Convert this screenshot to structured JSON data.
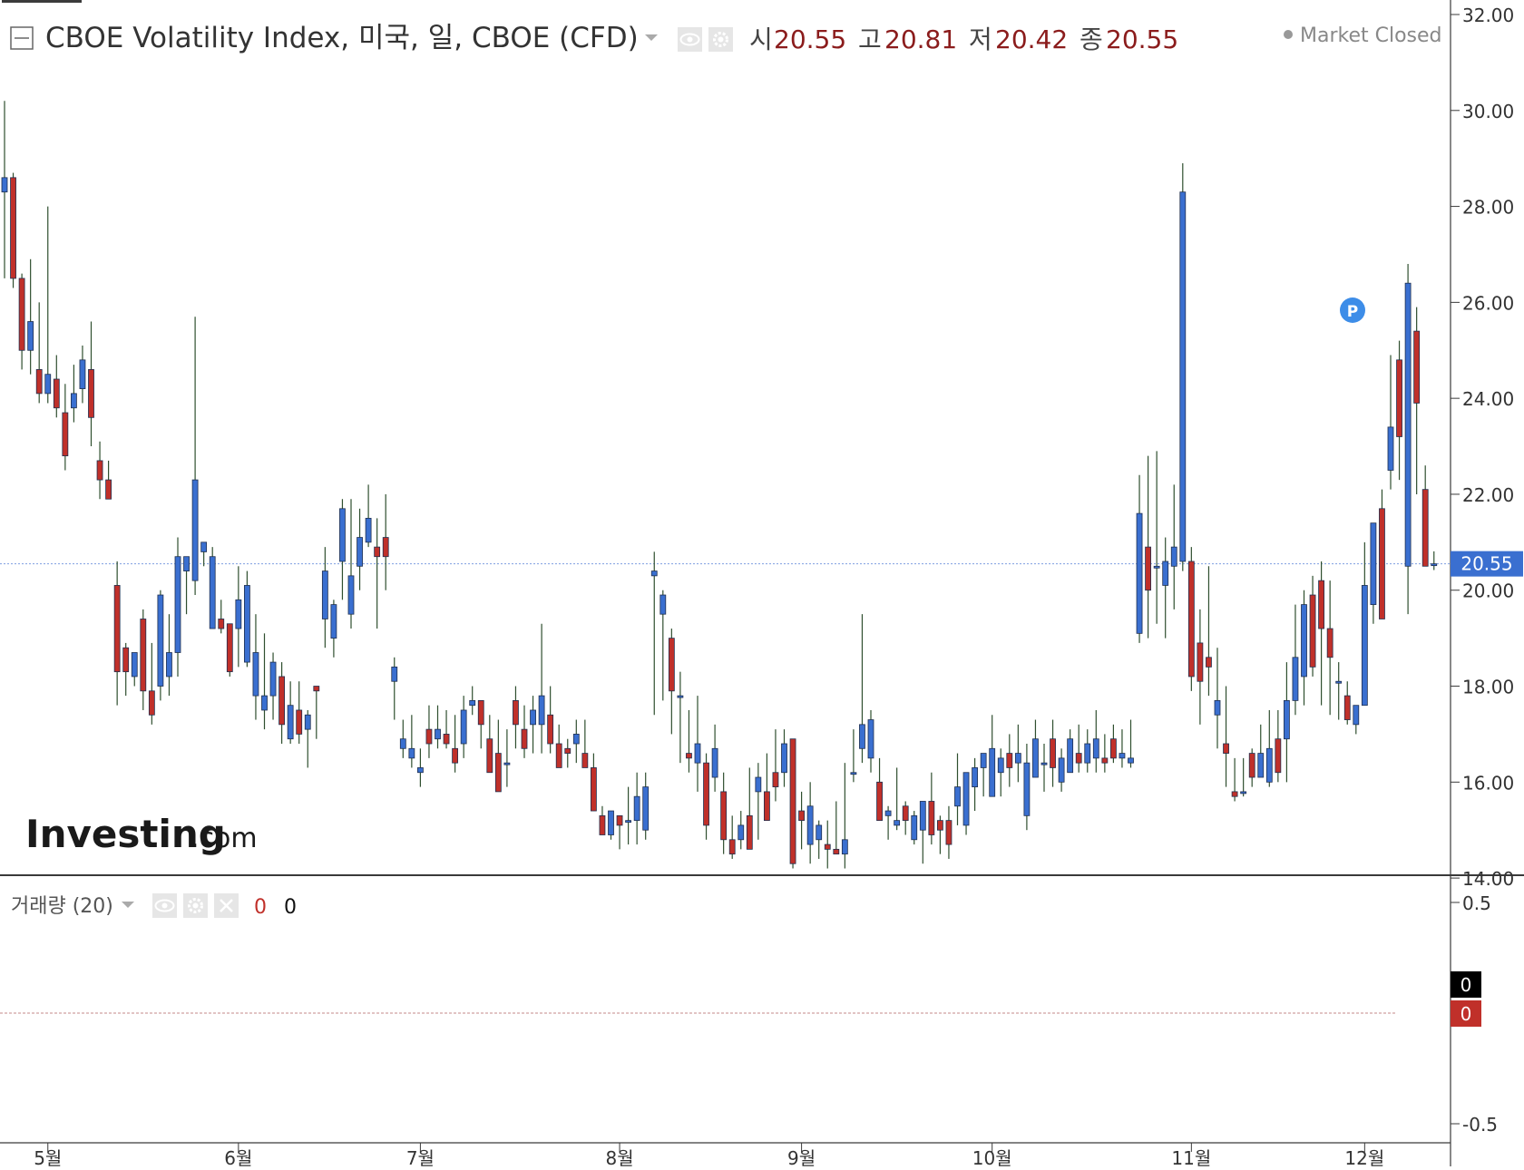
{
  "header": {
    "title": "CBOE Volatility Index, 미국, 일, CBOE (CFD)",
    "ohlc": [
      {
        "label": "시",
        "value": "20.55"
      },
      {
        "label": "고",
        "value": "20.81"
      },
      {
        "label": "저",
        "value": "20.42"
      },
      {
        "label": "종",
        "value": "20.55"
      }
    ],
    "market_status": "Market Closed"
  },
  "branding": {
    "logo_text": "Investing",
    "logo_suffix": ".com"
  },
  "volume_panel": {
    "label": "거래량 (20)",
    "value_red": "0",
    "value_black": "0",
    "axis_ticks": [
      "0.5",
      "-0.5"
    ],
    "badge_black": "0",
    "badge_red": "0"
  },
  "price_badge": "20.55",
  "marker_label": "P",
  "icons": [
    "collapse-icon",
    "dropdown-caret-icon",
    "eye-icon",
    "gear-icon",
    "close-icon",
    "market-status-dot-icon",
    "marker-p-icon"
  ],
  "colors": {
    "up": "#3a6fd0",
    "down": "#c0302a",
    "wick": "#2f4f2f",
    "badge": "#3a6fd0",
    "priceline": "#7f9fe0"
  },
  "chart_data": {
    "type": "candlestick",
    "ylim": [
      13.0,
      32.0
    ],
    "y_ticks": [
      "32.00",
      "30.00",
      "28.00",
      "26.00",
      "24.00",
      "22.00",
      "20.00",
      "18.00",
      "16.00",
      "14.00"
    ],
    "x_ticks": [
      {
        "label": "5월",
        "index": 5
      },
      {
        "label": "6월",
        "index": 27
      },
      {
        "label": "7월",
        "index": 48
      },
      {
        "label": "8월",
        "index": 71
      },
      {
        "label": "9월",
        "index": 92
      },
      {
        "label": "10월",
        "index": 114
      },
      {
        "label": "11월",
        "index": 137
      },
      {
        "label": "12월",
        "index": 157
      }
    ],
    "last_price": 20.55,
    "candles": [
      [
        28.3,
        30.2,
        26.5,
        28.6
      ],
      [
        28.6,
        28.7,
        26.3,
        26.5
      ],
      [
        26.5,
        26.6,
        24.6,
        25.0
      ],
      [
        25.0,
        26.9,
        24.5,
        25.6
      ],
      [
        24.6,
        26.0,
        23.9,
        24.1
      ],
      [
        24.1,
        28.0,
        23.9,
        24.5
      ],
      [
        24.4,
        24.9,
        23.6,
        23.8
      ],
      [
        23.7,
        24.3,
        22.5,
        22.8
      ],
      [
        23.8,
        24.7,
        23.5,
        24.1
      ],
      [
        24.2,
        25.1,
        23.9,
        24.8
      ],
      [
        24.6,
        25.6,
        23.0,
        23.6
      ],
      [
        22.7,
        23.1,
        21.9,
        22.3
      ],
      [
        22.3,
        22.7,
        21.9,
        21.9
      ],
      [
        20.1,
        20.6,
        17.6,
        18.3
      ],
      [
        18.8,
        18.9,
        17.8,
        18.3
      ],
      [
        18.2,
        18.7,
        18.0,
        18.7
      ],
      [
        19.4,
        19.6,
        17.5,
        17.9
      ],
      [
        17.9,
        18.9,
        17.2,
        17.4
      ],
      [
        18.0,
        20.0,
        17.7,
        19.9
      ],
      [
        18.2,
        19.5,
        17.8,
        18.7
      ],
      [
        18.7,
        21.1,
        18.2,
        20.7
      ],
      [
        20.4,
        20.6,
        19.5,
        20.7
      ],
      [
        20.2,
        25.7,
        19.9,
        22.3
      ],
      [
        20.8,
        21.0,
        20.5,
        21.0
      ],
      [
        19.2,
        20.9,
        19.2,
        20.7
      ],
      [
        19.4,
        19.8,
        19.1,
        19.2
      ],
      [
        19.3,
        19.3,
        18.2,
        18.3
      ],
      [
        19.2,
        20.5,
        18.4,
        19.8
      ],
      [
        18.5,
        20.4,
        18.4,
        20.1
      ],
      [
        17.8,
        19.5,
        17.3,
        18.7
      ],
      [
        17.5,
        19.1,
        17.1,
        17.8
      ],
      [
        17.8,
        18.7,
        17.3,
        18.5
      ],
      [
        18.2,
        18.5,
        16.8,
        17.2
      ],
      [
        16.9,
        18.1,
        16.8,
        17.6
      ],
      [
        17.5,
        18.1,
        16.8,
        17.0
      ],
      [
        17.1,
        17.5,
        16.3,
        17.4
      ],
      [
        18.0,
        18.0,
        16.9,
        17.9
      ],
      [
        19.4,
        20.9,
        18.8,
        20.4
      ],
      [
        19.0,
        19.8,
        18.6,
        19.7
      ],
      [
        20.6,
        21.9,
        19.8,
        21.7
      ],
      [
        19.5,
        21.9,
        19.2,
        20.3
      ],
      [
        20.5,
        21.7,
        20.0,
        21.1
      ],
      [
        21.0,
        22.2,
        20.9,
        21.5
      ],
      [
        20.9,
        21.5,
        19.2,
        20.7
      ],
      [
        21.1,
        22.0,
        20.0,
        20.7
      ],
      [
        18.1,
        18.6,
        17.3,
        18.4
      ],
      [
        16.7,
        17.3,
        16.5,
        16.9
      ],
      [
        16.5,
        17.4,
        16.3,
        16.7
      ],
      [
        16.2,
        16.7,
        15.9,
        16.3
      ],
      [
        17.1,
        17.6,
        16.5,
        16.8
      ],
      [
        16.9,
        17.6,
        16.7,
        17.1
      ],
      [
        17.0,
        17.5,
        16.7,
        16.8
      ],
      [
        16.7,
        17.4,
        16.2,
        16.4
      ],
      [
        16.8,
        17.8,
        16.5,
        17.5
      ],
      [
        17.6,
        18.0,
        17.4,
        17.7
      ],
      [
        17.7,
        17.7,
        16.7,
        17.2
      ],
      [
        16.9,
        17.4,
        16.3,
        16.2
      ],
      [
        16.6,
        17.3,
        15.8,
        15.8
      ],
      [
        16.4,
        17.1,
        15.9,
        16.4
      ],
      [
        17.7,
        18.0,
        16.7,
        17.2
      ],
      [
        17.1,
        17.6,
        16.5,
        16.7
      ],
      [
        17.2,
        17.8,
        16.6,
        17.5
      ],
      [
        17.2,
        19.3,
        16.6,
        17.8
      ],
      [
        17.4,
        18.0,
        16.6,
        16.8
      ],
      [
        16.8,
        17.2,
        16.6,
        16.3
      ],
      [
        16.7,
        16.9,
        16.3,
        16.6
      ],
      [
        16.8,
        17.3,
        16.4,
        17.0
      ],
      [
        16.6,
        17.3,
        16.4,
        16.3
      ],
      [
        16.3,
        16.6,
        15.4,
        15.4
      ],
      [
        15.3,
        15.5,
        14.9,
        14.9
      ],
      [
        14.9,
        15.4,
        14.8,
        15.4
      ],
      [
        15.3,
        15.3,
        14.6,
        15.1
      ],
      [
        15.2,
        15.9,
        14.7,
        15.2
      ],
      [
        15.2,
        16.2,
        14.7,
        15.7
      ],
      [
        15.0,
        16.2,
        14.8,
        15.9
      ],
      [
        20.3,
        20.8,
        17.4,
        20.4
      ],
      [
        19.5,
        20.0,
        17.7,
        19.9
      ],
      [
        19.0,
        19.2,
        17.0,
        17.9
      ],
      [
        17.8,
        18.3,
        16.4,
        17.8
      ],
      [
        16.6,
        17.5,
        16.2,
        16.5
      ],
      [
        16.4,
        17.8,
        15.8,
        16.8
      ],
      [
        16.4,
        16.6,
        14.8,
        15.1
      ],
      [
        16.1,
        17.2,
        15.8,
        16.7
      ],
      [
        15.8,
        16.2,
        14.5,
        14.8
      ],
      [
        14.8,
        15.3,
        14.4,
        14.5
      ],
      [
        14.8,
        15.4,
        14.6,
        15.1
      ],
      [
        15.3,
        16.3,
        14.6,
        14.6
      ],
      [
        15.8,
        16.4,
        14.8,
        16.1
      ],
      [
        15.8,
        16.6,
        15.4,
        15.2
      ],
      [
        16.2,
        17.1,
        15.6,
        15.9
      ],
      [
        16.2,
        17.1,
        15.9,
        16.8
      ],
      [
        16.9,
        16.9,
        14.2,
        14.3
      ],
      [
        15.4,
        15.8,
        14.6,
        15.2
      ],
      [
        14.7,
        16.0,
        14.3,
        15.5
      ],
      [
        14.8,
        15.2,
        14.4,
        15.1
      ],
      [
        14.7,
        15.2,
        14.2,
        14.6
      ],
      [
        14.6,
        15.6,
        14.5,
        14.5
      ],
      [
        14.5,
        16.4,
        14.2,
        14.8
      ],
      [
        16.2,
        17.1,
        16.0,
        16.2
      ],
      [
        16.7,
        19.5,
        16.4,
        17.2
      ],
      [
        16.5,
        17.5,
        16.2,
        17.3
      ],
      [
        16.0,
        16.5,
        15.2,
        15.2
      ],
      [
        15.3,
        15.5,
        14.8,
        15.4
      ],
      [
        15.1,
        16.3,
        15.0,
        15.2
      ],
      [
        15.5,
        15.6,
        14.9,
        15.2
      ],
      [
        14.8,
        15.4,
        14.7,
        15.3
      ],
      [
        15.0,
        15.5,
        14.3,
        15.6
      ],
      [
        15.6,
        16.2,
        14.7,
        14.9
      ],
      [
        15.2,
        15.3,
        14.5,
        15.0
      ],
      [
        15.2,
        15.5,
        14.4,
        14.7
      ],
      [
        15.5,
        16.6,
        15.1,
        15.9
      ],
      [
        15.1,
        15.8,
        14.9,
        16.2
      ],
      [
        15.9,
        16.5,
        15.4,
        16.3
      ],
      [
        16.3,
        16.5,
        15.7,
        16.6
      ],
      [
        15.7,
        17.4,
        15.8,
        16.7
      ],
      [
        16.2,
        16.7,
        15.7,
        16.5
      ],
      [
        16.6,
        17.0,
        15.9,
        16.3
      ],
      [
        16.4,
        17.2,
        16.0,
        16.6
      ],
      [
        15.3,
        16.8,
        15.0,
        16.4
      ],
      [
        16.1,
        17.3,
        16.1,
        16.9
      ],
      [
        16.4,
        16.8,
        15.8,
        16.4
      ],
      [
        16.9,
        17.3,
        15.9,
        16.3
      ],
      [
        16.0,
        16.7,
        15.8,
        16.5
      ],
      [
        16.2,
        17.1,
        16.2,
        16.9
      ],
      [
        16.6,
        17.2,
        16.2,
        16.4
      ],
      [
        16.4,
        17.1,
        16.2,
        16.8
      ],
      [
        16.5,
        17.5,
        16.2,
        16.9
      ],
      [
        16.5,
        17.0,
        16.2,
        16.4
      ],
      [
        16.9,
        17.2,
        16.4,
        16.5
      ],
      [
        16.5,
        17.1,
        16.3,
        16.6
      ],
      [
        16.4,
        17.3,
        16.3,
        16.5
      ],
      [
        19.1,
        22.4,
        18.9,
        21.6
      ],
      [
        20.9,
        22.8,
        19.0,
        20.0
      ],
      [
        20.5,
        22.9,
        19.3,
        20.5
      ],
      [
        20.1,
        21.1,
        19.0,
        20.6
      ],
      [
        20.5,
        22.2,
        19.6,
        20.9
      ],
      [
        20.6,
        28.9,
        20.4,
        28.3
      ],
      [
        20.6,
        20.9,
        17.9,
        18.2
      ],
      [
        18.9,
        19.6,
        17.2,
        18.1
      ],
      [
        18.6,
        20.5,
        17.8,
        18.4
      ],
      [
        17.4,
        18.8,
        16.7,
        17.7
      ],
      [
        16.8,
        18.0,
        15.9,
        16.6
      ],
      [
        15.8,
        16.5,
        15.6,
        15.7
      ],
      [
        15.8,
        16.5,
        15.7,
        15.8
      ],
      [
        16.6,
        16.7,
        15.9,
        16.1
      ],
      [
        16.1,
        17.2,
        16.4,
        16.6
      ],
      [
        16.0,
        17.5,
        15.9,
        16.7
      ],
      [
        16.9,
        17.5,
        16.0,
        16.2
      ],
      [
        16.9,
        18.5,
        16.0,
        17.7
      ],
      [
        17.7,
        19.7,
        17.4,
        18.6
      ],
      [
        18.2,
        20.0,
        17.6,
        19.7
      ],
      [
        19.9,
        20.3,
        18.2,
        18.4
      ],
      [
        20.2,
        20.6,
        17.6,
        19.2
      ],
      [
        19.2,
        20.2,
        17.4,
        18.6
      ],
      [
        18.1,
        18.5,
        17.3,
        18.1
      ],
      [
        17.8,
        18.1,
        17.2,
        17.3
      ],
      [
        17.2,
        17.3,
        17.0,
        17.6
      ],
      [
        17.6,
        21.0,
        17.6,
        20.1
      ],
      [
        19.7,
        21.4,
        19.3,
        21.4
      ],
      [
        21.7,
        22.1,
        19.4,
        19.4
      ],
      [
        22.5,
        24.9,
        22.1,
        23.4
      ],
      [
        24.8,
        25.2,
        22.3,
        23.2
      ],
      [
        20.5,
        26.8,
        19.5,
        26.4
      ],
      [
        25.4,
        25.9,
        22.0,
        23.9
      ],
      [
        22.1,
        22.6,
        20.5,
        20.5
      ],
      [
        20.55,
        20.81,
        20.42,
        20.55
      ]
    ]
  }
}
